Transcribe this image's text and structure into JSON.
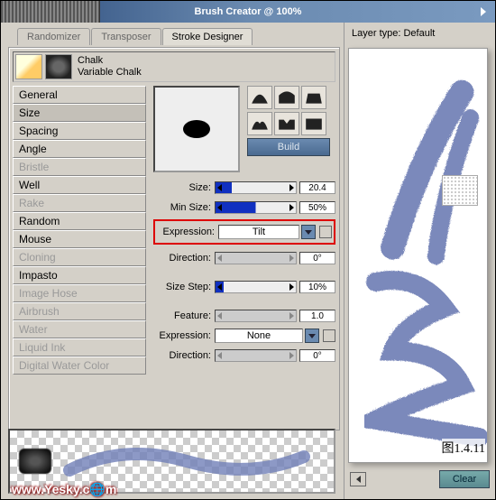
{
  "title": "Brush Creator @ 100%",
  "tabs": {
    "randomizer": "Randomizer",
    "transposer": "Transposer",
    "stroke_designer": "Stroke Designer"
  },
  "brush": {
    "name": "Chalk",
    "variant": "Variable Chalk"
  },
  "categories": {
    "general": "General",
    "size": "Size",
    "spacing": "Spacing",
    "angle": "Angle",
    "bristle": "Bristle",
    "well": "Well",
    "rake": "Rake",
    "random": "Random",
    "mouse": "Mouse",
    "cloning": "Cloning",
    "impasto": "Impasto",
    "image_hose": "Image Hose",
    "airbrush": "Airbrush",
    "water": "Water",
    "liquid_ink": "Liquid Ink",
    "digital_water": "Digital Water Color"
  },
  "build_label": "Build",
  "sliders": {
    "size": {
      "label": "Size:",
      "value": "20.4",
      "pct": 20
    },
    "min_size": {
      "label": "Min Size:",
      "value": "50%",
      "pct": 50
    },
    "expression1": {
      "label": "Expression:",
      "value": "Tilt"
    },
    "direction1": {
      "label": "Direction:",
      "value": "0°"
    },
    "size_step": {
      "label": "Size Step:",
      "value": "10%",
      "pct": 10
    },
    "feature": {
      "label": "Feature:",
      "value": "1.0",
      "pct": 5
    },
    "expression2": {
      "label": "Expression:",
      "value": "None"
    },
    "direction2": {
      "label": "Direction:",
      "value": "0°"
    }
  },
  "layer_type": "Layer type: Default",
  "fig_label": "图1.4.11",
  "clear_label": "Clear",
  "watermark": "www.Yesky.c🌐m"
}
